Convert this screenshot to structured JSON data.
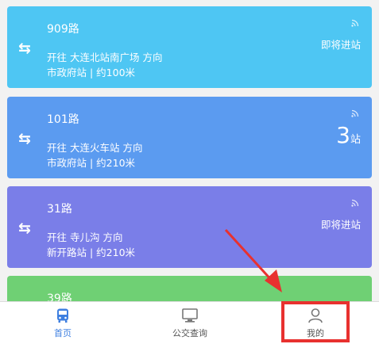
{
  "routes": [
    {
      "number": "909路",
      "direction": "开往 大连北站南广场 方向",
      "stop": "市政府站 | 约100米",
      "status": "即将进站",
      "color": "#4ec6f3"
    },
    {
      "number": "101路",
      "direction": "开往 大连火车站 方向",
      "stop": "市政府站 | 约210米",
      "count": "3",
      "count_unit": "站",
      "color": "#5b9bf0"
    },
    {
      "number": "31路",
      "direction": "开往 寺儿沟 方向",
      "stop": "新开路站 | 约210米",
      "status": "即将进站",
      "color": "#7a7ee8"
    },
    {
      "number": "39路",
      "color": "#6fd074"
    }
  ],
  "swap_glyph": "⇆",
  "nav": {
    "items": [
      {
        "label": "首页",
        "icon": "bus-icon",
        "active": true
      },
      {
        "label": "公交查询",
        "icon": "monitor-icon",
        "active": false
      },
      {
        "label": "我的",
        "icon": "user-icon",
        "active": false
      }
    ]
  },
  "annotation": {
    "color": "#e8312f"
  }
}
